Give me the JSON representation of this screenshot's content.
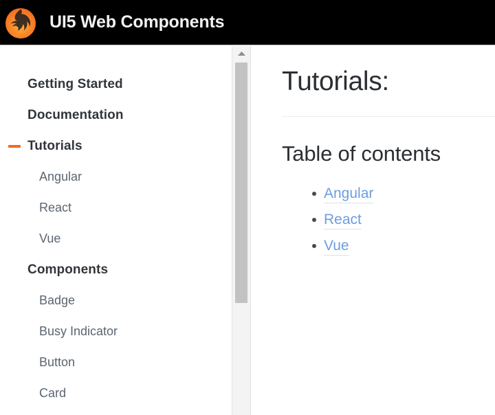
{
  "header": {
    "logo_icon": "phoenix-flame-logo",
    "title": "UI5 Web Components",
    "background": "#000000",
    "text_color": "#f2f2f2"
  },
  "sidebar": {
    "accent_color": "#ef6c24",
    "items": [
      {
        "label": "Getting Started",
        "level": "top",
        "expanded": false
      },
      {
        "label": "Documentation",
        "level": "top",
        "expanded": false
      },
      {
        "label": "Tutorials",
        "level": "top",
        "expanded": true
      },
      {
        "label": "Angular",
        "level": "sub"
      },
      {
        "label": "React",
        "level": "sub"
      },
      {
        "label": "Vue",
        "level": "sub"
      },
      {
        "label": "Components",
        "level": "top",
        "expanded": false
      },
      {
        "label": "Badge",
        "level": "sub"
      },
      {
        "label": "Busy Indicator",
        "level": "sub"
      },
      {
        "label": "Button",
        "level": "sub"
      },
      {
        "label": "Card",
        "level": "sub"
      }
    ]
  },
  "scrollbar": {
    "up_arrow_icon": "chevron-up-icon",
    "thumb_color": "#c2c2c2",
    "track_color": "#f3f3f3"
  },
  "main": {
    "page_title": "Tutorials:",
    "section_title": "Table of contents",
    "toc_link_color": "#6e9ddd",
    "toc": [
      {
        "label": "Angular"
      },
      {
        "label": "React"
      },
      {
        "label": "Vue"
      }
    ]
  }
}
